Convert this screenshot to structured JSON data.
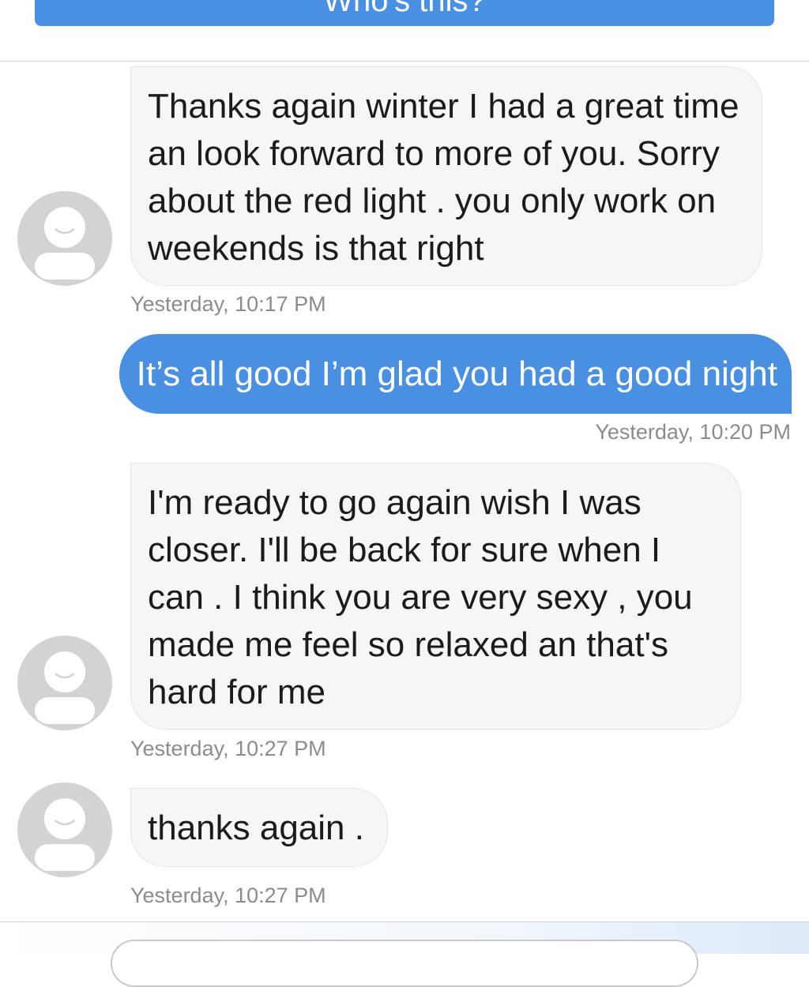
{
  "header": {
    "button_label": "Who's this?"
  },
  "messages": [
    {
      "direction": "incoming",
      "text": "Thanks again winter I had a great time an look forward to more of you. Sorry about the red light . you only work on weekends is that right",
      "timestamp": "Yesterday, 10:17 PM"
    },
    {
      "direction": "outgoing",
      "text": "It’s all good I’m glad you had a good night",
      "timestamp": "Yesterday, 10:20 PM"
    },
    {
      "direction": "incoming",
      "text": "I'm ready to go again wish I was closer. I'll be back for sure when I can . I think you are very sexy , you made me feel so relaxed an that's hard for me",
      "timestamp": "Yesterday, 10:27 PM"
    },
    {
      "direction": "incoming",
      "text": "thanks again .",
      "timestamp": "Yesterday, 10:27 PM"
    }
  ],
  "icons": {
    "avatar": "default-user-avatar-icon"
  },
  "colors": {
    "accent": "#4a90e2",
    "incoming_bubble": "#f6f6f6",
    "timestamp_text": "#8c8c8c",
    "avatar": "#d3d3d3"
  }
}
